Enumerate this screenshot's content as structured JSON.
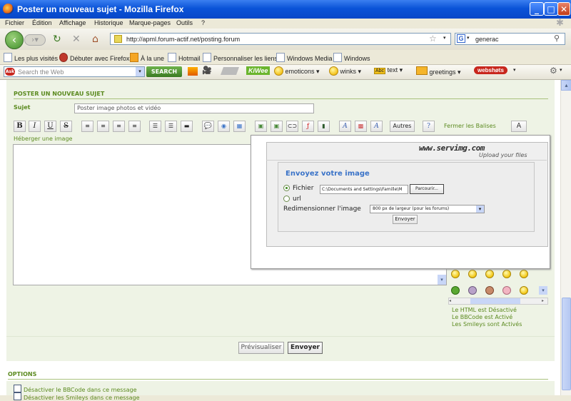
{
  "window": {
    "title": "Poster un nouveau sujet - Mozilla Firefox"
  },
  "menu": [
    "Fichier",
    "Édition",
    "Affichage",
    "Historique",
    "Marque-pages",
    "Outils",
    "?"
  ],
  "nav": {
    "url": "http://apml.forum-actif.net/posting.forum",
    "search_value": "generac"
  },
  "bookmarks": [
    "Les plus visités",
    "Débuter avec Firefox",
    "À la une",
    "Hotmail",
    "Personnaliser les liens",
    "Windows Media",
    "Windows"
  ],
  "toolbar": {
    "search_placeholder": "Search the Web",
    "search_button": "SEARCH",
    "emoticons": "emoticons",
    "winks": "winks",
    "text": "text",
    "greetings": "greetings",
    "webshots": "webshøts",
    "kiwee": "KiWee"
  },
  "form": {
    "heading": "POSTER UN NOUVEAU SUJET",
    "subject_label": "Sujet",
    "subject_value": "Poster image photos et vidéo",
    "format_buttons": [
      "B",
      "I",
      "U",
      "S"
    ],
    "autres": "Autres",
    "close_tags": "Fermer les Balises",
    "host_image": "Héberger une image"
  },
  "upload": {
    "logo": "www.servimg.com",
    "tagline": "Upload your files",
    "title": "Envoyez votre image",
    "file_label": "Fichier",
    "file_value": "C:\\Documents and Settings\\Famille\\M",
    "browse": "Parcourir...",
    "url_label": "url",
    "resize_label": "Redimensionner l'image",
    "resize_value": "800 px de largeur (pour les forums)",
    "send": "Envoyer"
  },
  "status": {
    "html": "Le HTML est Désactivé",
    "bbcode": "Le BBCode est Activé",
    "smileys": "Les Smileys sont Activés"
  },
  "actions": {
    "preview": "Prévisualiser",
    "send": "Envoyer"
  },
  "options": {
    "heading": "OPTIONS",
    "disable_bbcode": "Désactiver le BBCode dans ce message",
    "disable_smileys": "Désactiver les Smileys dans ce message"
  },
  "colors": {
    "accent_green": "#5b8a1f",
    "title_blue": "#0a53d8",
    "panel_bg": "#eef3e5"
  }
}
